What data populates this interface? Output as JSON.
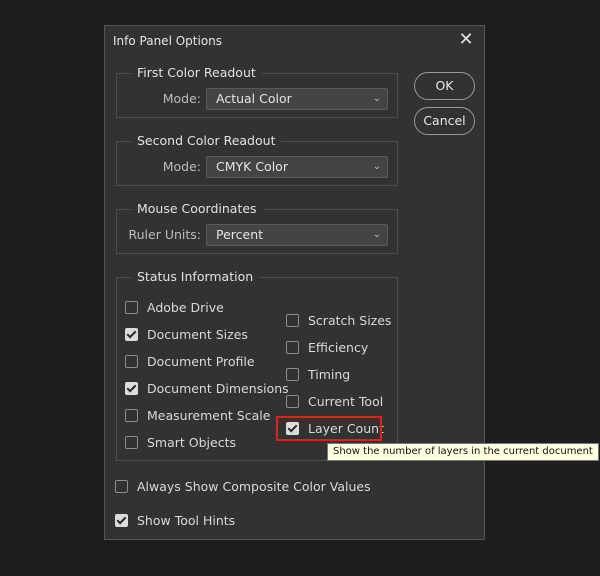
{
  "dialog": {
    "title": "Info Panel Options",
    "buttons": {
      "ok": "OK",
      "cancel": "Cancel"
    }
  },
  "first_readout": {
    "legend": "First Color Readout",
    "mode_label": "Mode:",
    "mode_value": "Actual Color"
  },
  "second_readout": {
    "legend": "Second Color Readout",
    "mode_label": "Mode:",
    "mode_value": "CMYK Color"
  },
  "mouse_coords": {
    "legend": "Mouse Coordinates",
    "units_label": "Ruler Units:",
    "units_value": "Percent"
  },
  "status": {
    "legend": "Status Information",
    "left": [
      {
        "label": "Adobe Drive",
        "checked": false
      },
      {
        "label": "Document Sizes",
        "checked": true
      },
      {
        "label": "Document Profile",
        "checked": false
      },
      {
        "label": "Document Dimensions",
        "checked": true
      },
      {
        "label": "Measurement Scale",
        "checked": false
      },
      {
        "label": "Smart Objects",
        "checked": false
      }
    ],
    "right": [
      {
        "label": "Scratch Sizes",
        "checked": false
      },
      {
        "label": "Efficiency",
        "checked": false
      },
      {
        "label": "Timing",
        "checked": false
      },
      {
        "label": "Current Tool",
        "checked": false
      },
      {
        "label": "Layer Count",
        "checked": true
      }
    ]
  },
  "options": {
    "composite": {
      "label": "Always Show Composite Color Values",
      "checked": false
    },
    "tool_hints": {
      "label": "Show Tool Hints",
      "checked": true
    }
  },
  "tooltip": "Show the number of layers in the current document",
  "colors": {
    "highlight": "#e0201c",
    "tooltip_bg": "#ffffe1"
  }
}
